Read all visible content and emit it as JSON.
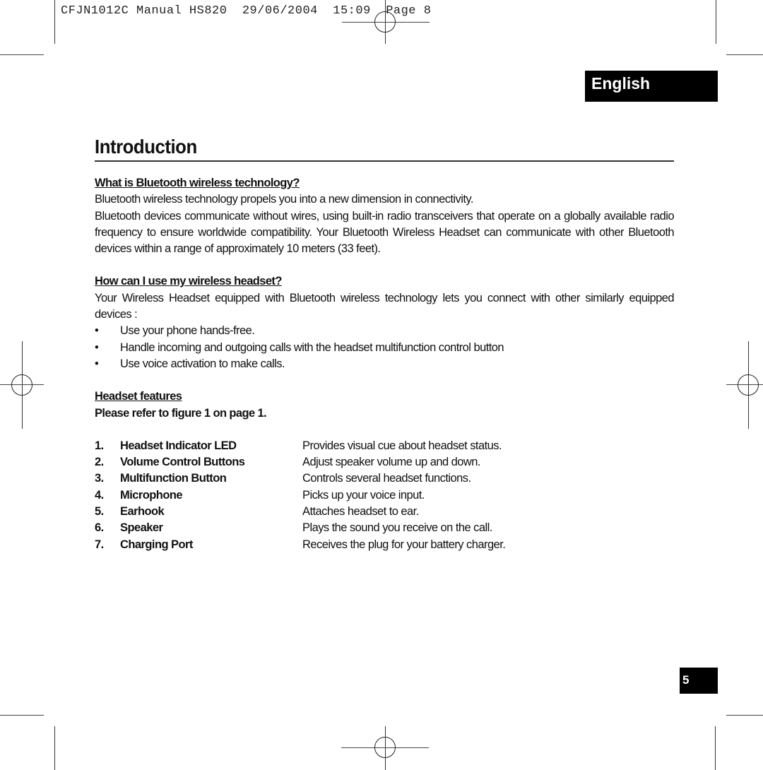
{
  "slug": {
    "doc_code": "CFJN1012C Manual HS820",
    "date": "29/06/2004",
    "time": "15:09",
    "page": "Page 8"
  },
  "language_tab": "English",
  "page_title": "Introduction",
  "sections": {
    "bluetooth": {
      "heading": "What is Bluetooth wireless technology?",
      "line1": "Bluetooth wireless technology propels you into a new dimension in connectivity.",
      "para": "Bluetooth devices communicate without wires, using built-in radio transceivers that operate on a globally available radio frequency to ensure worldwide compatibility. Your Bluetooth Wireless Headset can communicate with other Bluetooth devices within a range of approximately 10 meters (33 feet)."
    },
    "usage": {
      "heading": "How can I use my wireless headset?",
      "para": "Your Wireless Headset equipped with Bluetooth wireless technology lets you connect with other similarly equipped devices :",
      "bullet_glyph": "•",
      "bullets": [
        "Use your phone hands-free.",
        "Handle incoming and outgoing calls with the headset multifunction control button",
        "Use voice activation to make calls."
      ]
    },
    "features": {
      "heading": "Headset features",
      "reference": "Please refer to figure 1 on page 1.",
      "items": [
        {
          "num": "1.",
          "name": "Headset Indicator LED",
          "desc": "Provides visual cue about headset status."
        },
        {
          "num": "2.",
          "name": "Volume Control Buttons",
          "desc": "Adjust speaker volume up and down."
        },
        {
          "num": "3.",
          "name": "Multifunction Button",
          "desc": "Controls several headset functions."
        },
        {
          "num": "4.",
          "name": "Microphone",
          "desc": "Picks up your voice input."
        },
        {
          "num": "5.",
          "name": "Earhook",
          "desc": "Attaches headset to ear."
        },
        {
          "num": "6.",
          "name": "Speaker",
          "desc": "Plays the sound you receive on the call."
        },
        {
          "num": "7.",
          "name": "Charging Port",
          "desc": "Receives the plug for your battery charger."
        }
      ]
    }
  },
  "page_number": "5"
}
